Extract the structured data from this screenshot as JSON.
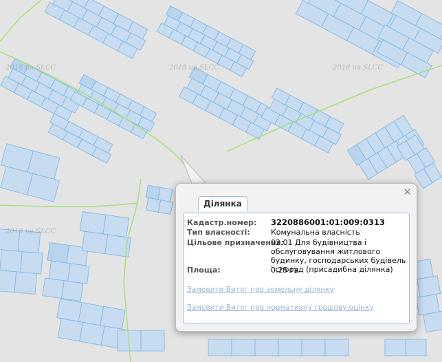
{
  "map": {
    "watermark": "2018 ua.SLCC",
    "colors": {
      "background": "#e4e4e4",
      "parcel_fill": "#c7dcf0",
      "parcel_stroke": "#79b4e6",
      "boundary_line": "#a6e07a"
    }
  },
  "popup": {
    "tab_label": "Ділянка",
    "close_icon": "close-x-icon",
    "fields": [
      {
        "label": "Кадастр.номер:",
        "value": "3220886001:01:009:0313"
      },
      {
        "label": "Тип власності:",
        "value": "Комунальна власність"
      },
      {
        "label": "Цільове призначення:",
        "value": "02.01 Для будівництва і обслуговування житлового будинку, господарських будівель і споруд (присадибна ділянка)"
      },
      {
        "label": "Площа:",
        "value": "0.25 га"
      }
    ],
    "links": [
      "Замовити Витяг про земельну ділянку",
      "Замовити Витяг про нормативну грошову оцінку"
    ]
  }
}
